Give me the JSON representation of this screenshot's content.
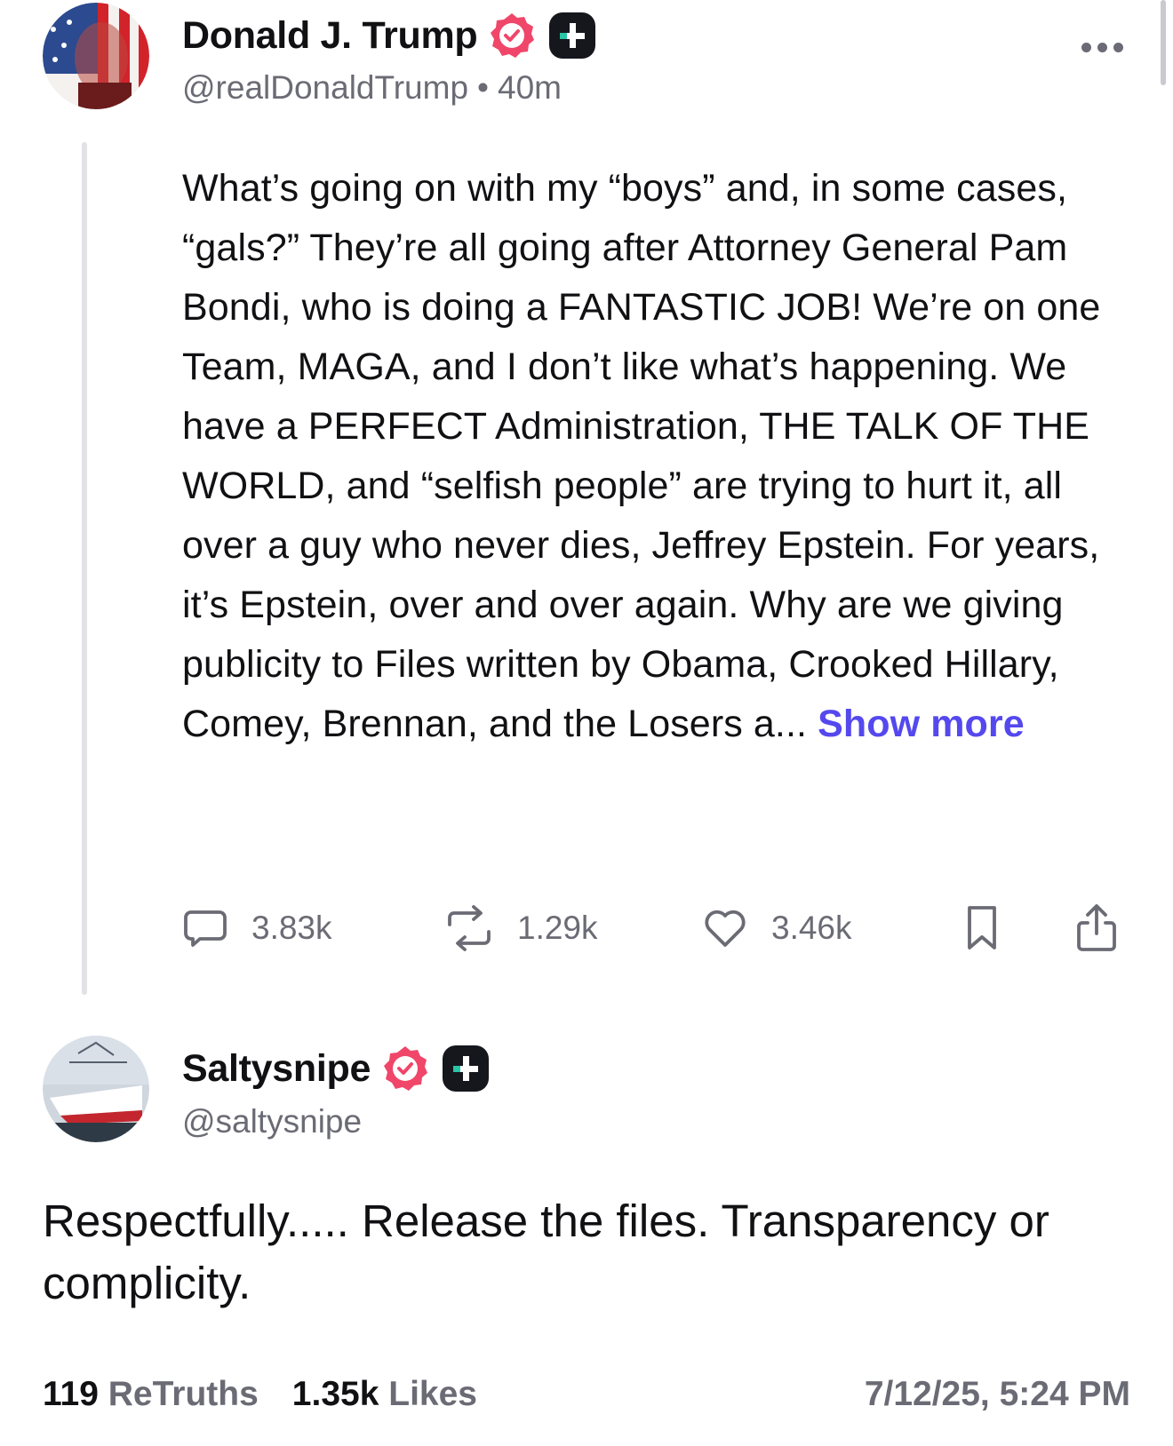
{
  "parent_post": {
    "author": {
      "display_name": "Donald J. Trump",
      "handle": "@realDonaldTrump",
      "verified": true,
      "plus_member": true
    },
    "separator": "•",
    "time_ago": "40m",
    "body": "What’s going on with my “boys” and, in some cases, “gals?” They’re all going after Attorney General Pam Bondi, who is doing a FANTASTIC JOB! We’re on one Team, MAGA, and I don’t like what’s happening. We have a PERFECT Administration, THE TALK OF THE WORLD, and “selfish people” are trying to hurt it, all over a guy who never dies, Jeffrey Epstein. For years, it’s Epstein, over and over again. Why are we giving publicity to Files written by Obama, Crooked Hillary, Comey, Brennan, and the Losers a...",
    "show_more_label": "Show more",
    "actions": {
      "replies": "3.83k",
      "retruths": "1.29k",
      "likes": "3.46k"
    }
  },
  "reply": {
    "author": {
      "display_name": "Saltysnipe",
      "handle": "@saltysnipe",
      "verified": true,
      "plus_member": true
    },
    "body": "Respectfully..... Release the files. Transparency or complicity.",
    "stats": {
      "retruths_count": "119",
      "retruths_label": "ReTruths",
      "likes_count": "1.35k",
      "likes_label": "Likes"
    },
    "timestamp": "7/12/25, 5:24 PM"
  },
  "colors": {
    "text": "#111114",
    "muted": "#6b6b75",
    "accent_link": "#5448ee",
    "verified_badge": "#f0466a",
    "plus_badge": "#15171c",
    "plus_badge_accent": "#29c5a5",
    "thread_line": "#e1e1e6"
  },
  "icons": {
    "verified": "verified-badge-icon",
    "plus": "truth-plus-icon",
    "more": "more-horizontal-icon",
    "reply": "comment-bubble-icon",
    "retruth": "retruth-arrows-icon",
    "like": "heart-icon",
    "bookmark": "bookmark-icon",
    "share": "share-upload-icon"
  }
}
